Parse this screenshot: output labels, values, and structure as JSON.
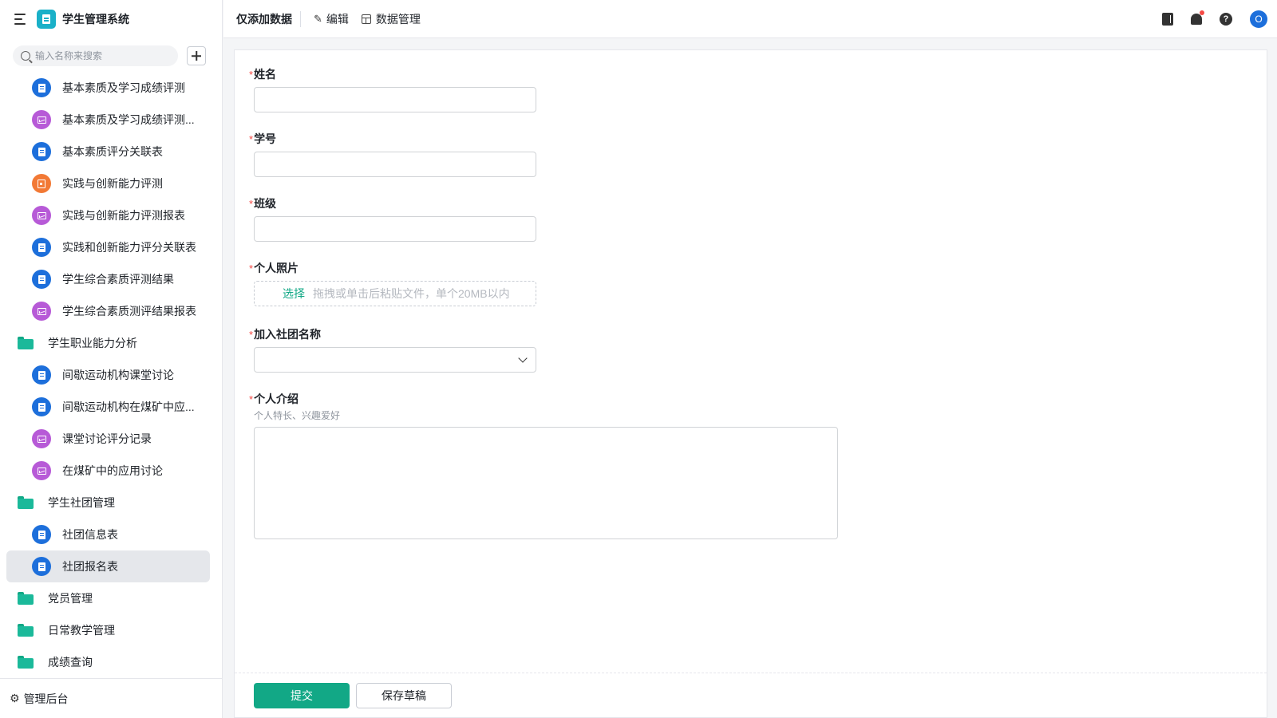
{
  "app": {
    "title": "学生管理系统"
  },
  "search": {
    "placeholder": "输入名称来搜索"
  },
  "sidebar": {
    "items": [
      {
        "type": "form",
        "label": "基本素质及学习成绩评测"
      },
      {
        "type": "report",
        "label": "基本素质及学习成绩评测..."
      },
      {
        "type": "form",
        "label": "基本素质评分关联表"
      },
      {
        "type": "flow",
        "label": "实践与创新能力评测"
      },
      {
        "type": "report",
        "label": "实践与创新能力评测报表"
      },
      {
        "type": "form",
        "label": "实践和创新能力评分关联表"
      },
      {
        "type": "form",
        "label": "学生综合素质评测结果"
      },
      {
        "type": "report",
        "label": "学生综合素质测评结果报表"
      },
      {
        "type": "folder",
        "label": "学生职业能力分析"
      },
      {
        "type": "form",
        "label": "间歇运动机构课堂讨论"
      },
      {
        "type": "form",
        "label": "间歇运动机构在煤矿中应..."
      },
      {
        "type": "report",
        "label": "课堂讨论评分记录"
      },
      {
        "type": "report",
        "label": "在煤矿中的应用讨论"
      },
      {
        "type": "folder",
        "label": "学生社团管理"
      },
      {
        "type": "form",
        "label": "社团信息表"
      },
      {
        "type": "form",
        "label": "社团报名表",
        "active": true
      },
      {
        "type": "folder",
        "label": "党员管理"
      },
      {
        "type": "folder",
        "label": "日常教学管理"
      },
      {
        "type": "folder",
        "label": "成绩查询"
      }
    ],
    "footer_label": "管理后台"
  },
  "topbar": {
    "title": "仅添加数据",
    "edit_label": "编辑",
    "data_manage_label": "数据管理",
    "avatar_letter": "O"
  },
  "form": {
    "name_label": "姓名",
    "student_id_label": "学号",
    "class_label": "班级",
    "photo_label": "个人照片",
    "photo_pick": "选择",
    "photo_tip": "拖拽或单击后粘贴文件，单个20MB以内",
    "club_label": "加入社团名称",
    "intro_label": "个人介绍",
    "intro_hint": "个人特长、兴趣爱好",
    "required_mark": "*"
  },
  "footer": {
    "submit_label": "提交",
    "draft_label": "保存草稿"
  },
  "colors": {
    "accent": "#12a886",
    "form_icon": "#1d6fdb",
    "report_icon": "#b75ad7",
    "flow_icon": "#f27935",
    "required": "#f54a45"
  }
}
